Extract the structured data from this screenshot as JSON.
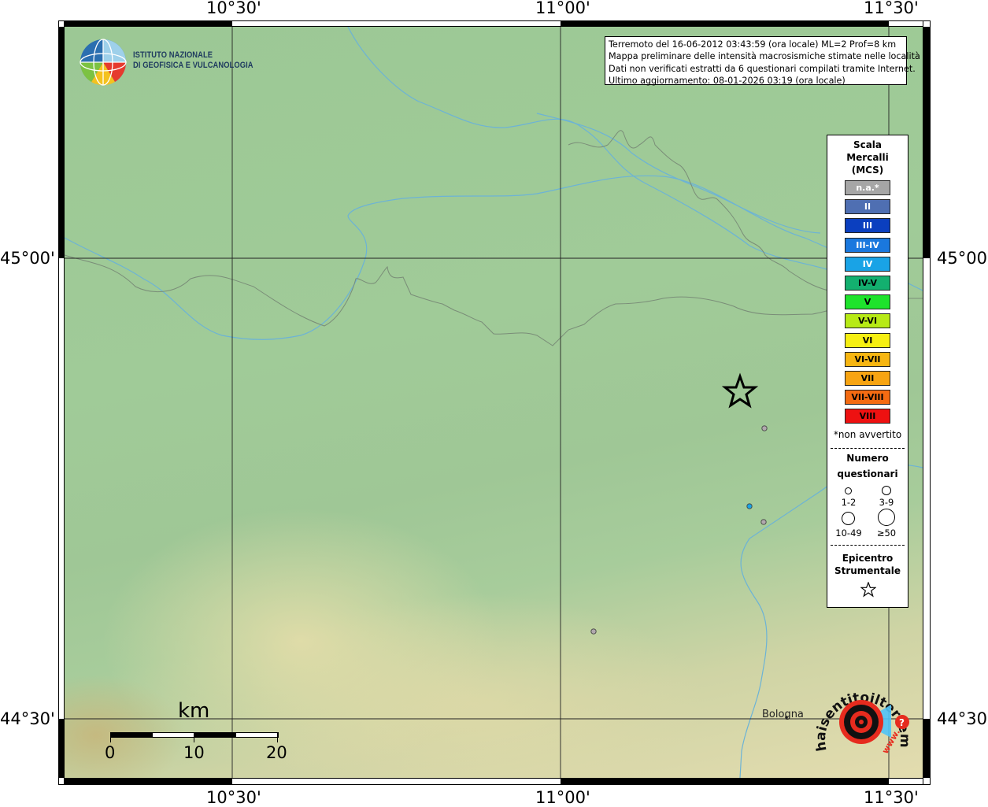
{
  "institute": {
    "name_line1": "ISTITUTO NAZIONALE",
    "name_line2": "DI GEOFISICA E VULCANOLOGIA"
  },
  "info_box": {
    "line1": "Terremoto del 16-06-2012 03:43:59 (ora locale) ML=2 Prof=8 km",
    "line2": "Mappa preliminare delle intensità macrosismiche stimate nelle località",
    "line3": "Dati non verificati estratti da 6 questionari compilati tramite Internet.",
    "line4": "Ultimo aggiornamento: 08-01-2026 03:19 (ora locale)"
  },
  "axes": {
    "lon_ticks": [
      "10°30'",
      "11°00'",
      "11°30'"
    ],
    "lat_ticks": [
      "45°00'",
      "44°30'"
    ]
  },
  "legend": {
    "title_line1": "Scala",
    "title_line2": "Mercalli",
    "title_line3": "(MCS)",
    "items": [
      {
        "label": "n.a.*",
        "color": "#a6a6a6",
        "text_color": "#ffffff"
      },
      {
        "label": "II",
        "color": "#4f6fb2",
        "text_color": "#ffffff"
      },
      {
        "label": "III",
        "color": "#0b3fbf",
        "text_color": "#ffffff"
      },
      {
        "label": "III-IV",
        "color": "#1a78de",
        "text_color": "#ffffff"
      },
      {
        "label": "IV",
        "color": "#19a3e6",
        "text_color": "#ffffff"
      },
      {
        "label": "IV-V",
        "color": "#13b06f",
        "text_color": "#000000"
      },
      {
        "label": "V",
        "color": "#1ee32c",
        "text_color": "#000000"
      },
      {
        "label": "V-VI",
        "color": "#b7ea16",
        "text_color": "#000000"
      },
      {
        "label": "VI",
        "color": "#f6ef12",
        "text_color": "#000000"
      },
      {
        "label": "VI-VII",
        "color": "#f7b612",
        "text_color": "#000000"
      },
      {
        "label": "VII",
        "color": "#f7a412",
        "text_color": "#000000"
      },
      {
        "label": "VII-VIII",
        "color": "#f46b12",
        "text_color": "#000000"
      },
      {
        "label": "VIII",
        "color": "#ee1111",
        "text_color": "#000000"
      }
    ],
    "footnote": "*non avvertito",
    "count_title_line1": "Numero",
    "count_title_line2": "questionari",
    "count_classes": [
      "1-2",
      "3-9",
      "10-49",
      "≥50"
    ],
    "epicenter_title_line1": "Epicentro",
    "epicenter_title_line2": "Strumentale"
  },
  "scale_bar": {
    "unit": "km",
    "ticks": [
      "0",
      "10",
      "20"
    ]
  },
  "places": [
    {
      "name": "Bologna"
    }
  ],
  "observations": [
    {
      "intensity": "n.a.",
      "color": "#b0a7ad"
    },
    {
      "intensity": "IV",
      "color": "#19a3e6"
    },
    {
      "intensity": "n.a.",
      "color": "#b0a7ad"
    },
    {
      "intensity": "n.a.",
      "color": "#b0a7ad"
    }
  ],
  "epicenter": {
    "symbol": "star"
  },
  "hsit_logo": {
    "text_main": "haisentitoilterremoto.it",
    "text_url": "www."
  }
}
